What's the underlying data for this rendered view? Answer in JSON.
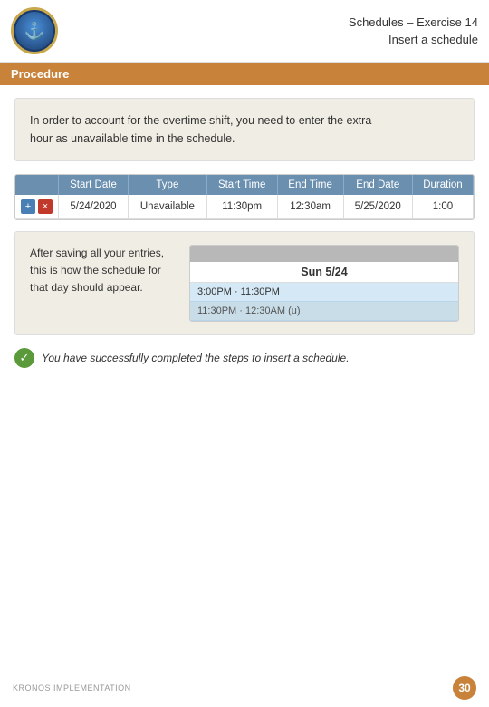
{
  "header": {
    "title_line1": "Schedules – Exercise 14",
    "title_line2": "Insert a schedule"
  },
  "procedure_bar": {
    "label": "Procedure"
  },
  "info_box": {
    "text_line1": "In order to account for the overtime shift, you need to enter the extra",
    "text_line2": "hour as unavailable time in the schedule."
  },
  "table": {
    "columns": [
      "",
      "Start Date",
      "Type",
      "Start Time",
      "End Time",
      "End Date",
      "Duration"
    ],
    "row": {
      "controls": [
        "+",
        "×"
      ],
      "start_date": "5/24/2020",
      "type": "Unavailable",
      "start_time": "11:30pm",
      "end_time": "12:30am",
      "end_date": "5/25/2020",
      "duration": "1:00"
    }
  },
  "preview": {
    "description_line1": "After saving all your entries,",
    "description_line2": "this is how the schedule for",
    "description_line3": "that day should appear.",
    "date_header": "Sun 5/24",
    "slot1": "3:00PM · 11:30PM",
    "slot2": "11:30PM · 12:30AM (u)"
  },
  "success": {
    "message": "You have successfully completed the steps to insert a schedule."
  },
  "footer": {
    "label": "KRONOS IMPLEMENTATION",
    "page_number": "30"
  }
}
